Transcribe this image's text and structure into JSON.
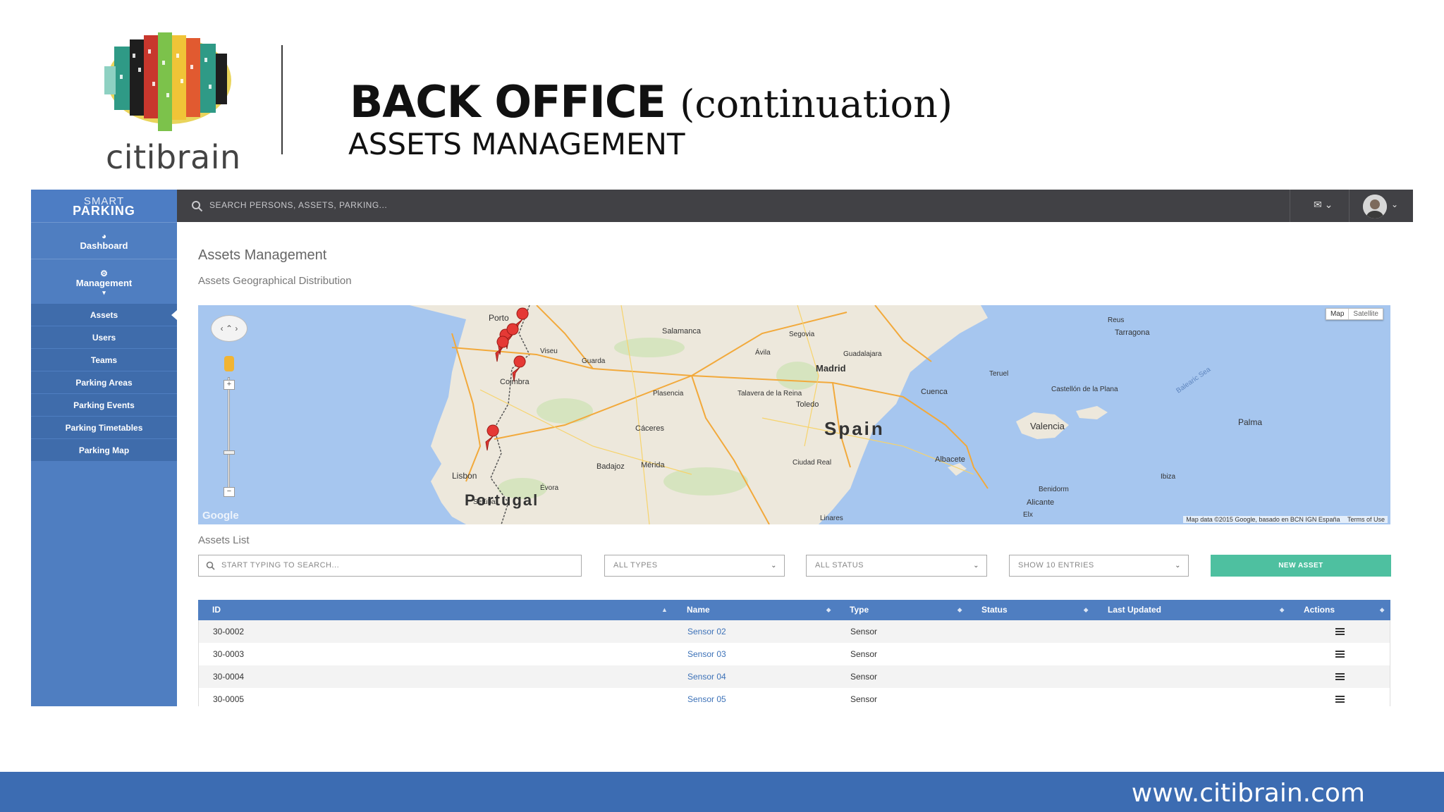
{
  "slide": {
    "logo_word": "citibrain",
    "title_main": "BACK OFFICE",
    "title_paren": "(continuation)",
    "title_sub": "ASSETS MANAGEMENT",
    "footer_url": "www.citibrain.com"
  },
  "sidebar": {
    "brand_line1": "SMART",
    "brand_line2": "PARKING",
    "dashboard": "Dashboard",
    "management": "Management",
    "items": [
      {
        "label": "Assets",
        "active": true
      },
      {
        "label": "Users"
      },
      {
        "label": "Teams"
      },
      {
        "label": "Parking Areas"
      },
      {
        "label": "Parking Events"
      },
      {
        "label": "Parking Timetables"
      },
      {
        "label": "Parking Map"
      }
    ]
  },
  "topbar": {
    "search_placeholder": "SEARCH PERSONS, ASSETS, PARKING..."
  },
  "main": {
    "title": "Assets Management",
    "subtitle": "Assets Geographical Distribution",
    "map": {
      "type_map": "Map",
      "type_satellite": "Satellite",
      "google": "Google",
      "attribution": "Map data ©2015 Google, basado en BCN IGN España",
      "terms": "Terms of Use",
      "labels": {
        "portugal": "Portugal",
        "spain": "Spain",
        "porto": "Porto",
        "coimbra": "Coimbra",
        "lisbon": "Lisbon",
        "madrid": "Madrid",
        "salamanca": "Salamanca",
        "valencia": "Valencia",
        "palma": "Palma",
        "toledo": "Toledo",
        "caceres": "Cáceres",
        "badajoz": "Badajoz",
        "merida": "Mérida",
        "albacete": "Albacete",
        "alicante": "Alicante",
        "cuenca": "Cuenca",
        "tarragona": "Tarragona",
        "segovia": "Segovia",
        "avila": "Ávila",
        "guadalajara": "Guadalajara",
        "teruel": "Teruel",
        "castellon": "Castellón de la Plana",
        "plasencia": "Plasencia",
        "ciudad_real": "Ciudad Real",
        "talavera": "Talavera de la Reina",
        "guarda": "Guarda",
        "viseu": "Viseu",
        "setubal": "Setúbal",
        "evora": "Évora",
        "linares": "Linares",
        "ibiza": "Ibiza",
        "benidorm": "Benidorm",
        "elche": "Elx",
        "reus": "Reus",
        "sea": "Balearic Sea"
      }
    },
    "list_title": "Assets List",
    "search_placeholder": "START TYPING TO SEARCH...",
    "filter_types": "ALL TYPES",
    "filter_status": "ALL STATUS",
    "page_size": "SHOW 10 ENTRIES",
    "new_asset": "NEW ASSET",
    "table": {
      "headers": [
        "ID",
        "Name",
        "Type",
        "Status",
        "Last Updated",
        "Actions"
      ],
      "rows": [
        {
          "id": "30-0002",
          "name": "Sensor 02",
          "type": "Sensor",
          "status": "",
          "updated": ""
        },
        {
          "id": "30-0003",
          "name": "Sensor 03",
          "type": "Sensor",
          "status": "",
          "updated": ""
        },
        {
          "id": "30-0004",
          "name": "Sensor 04",
          "type": "Sensor",
          "status": "",
          "updated": ""
        },
        {
          "id": "30-0005",
          "name": "Sensor 05",
          "type": "Sensor",
          "status": "",
          "updated": ""
        }
      ]
    }
  },
  "colors": {
    "sidebar": "#4f7ec1",
    "topbar": "#414145",
    "accent_green": "#4ec0a0",
    "footer": "#3c6cb2",
    "water": "#a6c6ef",
    "land": "#ede8dc",
    "marker": "#e53935"
  }
}
